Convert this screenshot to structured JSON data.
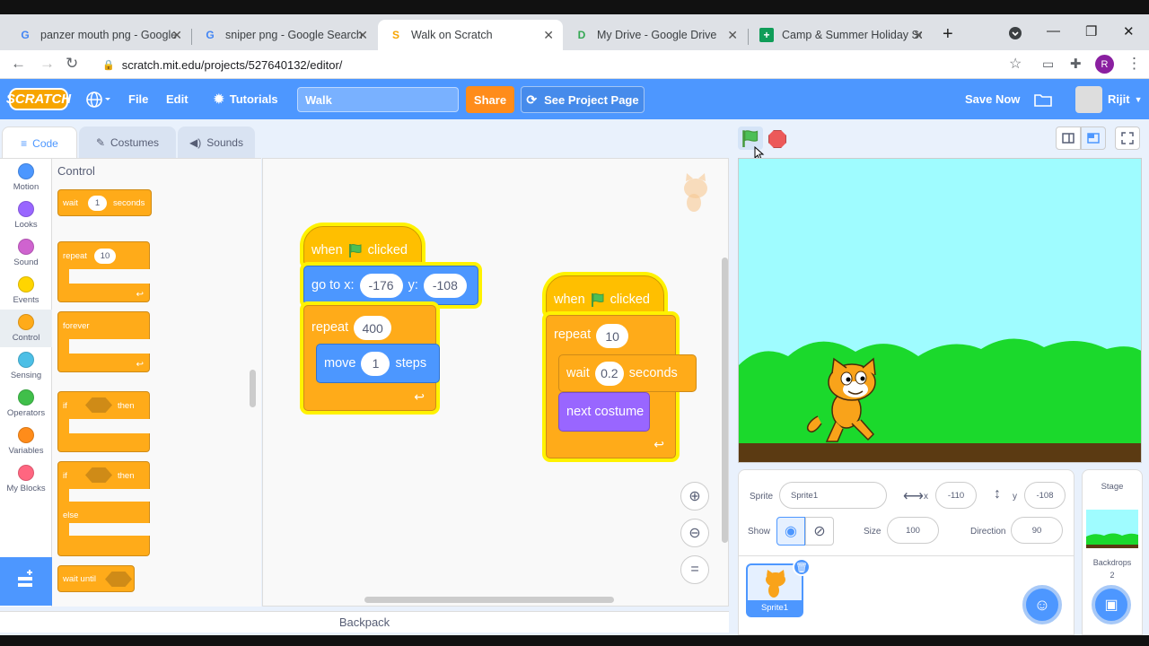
{
  "browser": {
    "tabs": [
      {
        "title": "panzer mouth png - Google S",
        "favicon": "G"
      },
      {
        "title": "sniper png - Google Search",
        "favicon": "G"
      },
      {
        "title": "Walk on Scratch",
        "favicon": "S"
      },
      {
        "title": "My Drive - Google Drive",
        "favicon": "D"
      },
      {
        "title": "Camp & Summer Holiday Sc",
        "favicon": "+"
      }
    ],
    "url": "scratch.mit.edu/projects/527640132/editor/",
    "profile_initial": "R"
  },
  "menu": {
    "logo": "SCRATCH",
    "file": "File",
    "edit": "Edit",
    "tutorials": "Tutorials",
    "project_title": "Walk",
    "share": "Share",
    "see_project_page": "See Project Page",
    "save_now": "Save Now",
    "user": "Rijit"
  },
  "editor_tabs": {
    "code": "Code",
    "costumes": "Costumes",
    "sounds": "Sounds"
  },
  "categories": [
    {
      "label": "Motion",
      "color": "#4c97ff"
    },
    {
      "label": "Looks",
      "color": "#9966ff"
    },
    {
      "label": "Sound",
      "color": "#cf63cf"
    },
    {
      "label": "Events",
      "color": "#ffd500"
    },
    {
      "label": "Control",
      "color": "#ffab19"
    },
    {
      "label": "Sensing",
      "color": "#4cbfe6"
    },
    {
      "label": "Operators",
      "color": "#40bf4a"
    },
    {
      "label": "Variables",
      "color": "#ff8c1a"
    },
    {
      "label": "My Blocks",
      "color": "#ff6680"
    }
  ],
  "palette": {
    "heading": "Control",
    "wait": "wait",
    "wait_val": "1",
    "seconds": "seconds",
    "repeat": "repeat",
    "repeat_val": "10",
    "forever": "forever",
    "if": "if",
    "then": "then",
    "else": "else",
    "wait_until": "wait until"
  },
  "script1": {
    "when": "when",
    "clicked": "clicked",
    "goto": "go to x:",
    "x": "-176",
    "y_label": "y:",
    "y": "-108",
    "repeat": "repeat",
    "repeat_val": "400",
    "move": "move",
    "move_val": "1",
    "steps": "steps"
  },
  "script2": {
    "when": "when",
    "clicked": "clicked",
    "repeat": "repeat",
    "repeat_val": "10",
    "wait": "wait",
    "wait_val": "0.2",
    "seconds": "seconds",
    "next_costume": "next costume"
  },
  "zoom": {
    "reset": "="
  },
  "backpack": "Backpack",
  "sprite_info": {
    "sprite_label": "Sprite",
    "sprite_name": "Sprite1",
    "x_label": "x",
    "x": "-110",
    "y_label": "y",
    "y": "-108",
    "show_label": "Show",
    "size_label": "Size",
    "size": "100",
    "direction_label": "Direction",
    "direction": "90"
  },
  "sprite_list": [
    {
      "name": "Sprite1"
    }
  ],
  "stage_panel": {
    "title": "Stage",
    "backdrops_label": "Backdrops",
    "backdrops_count": "2"
  }
}
